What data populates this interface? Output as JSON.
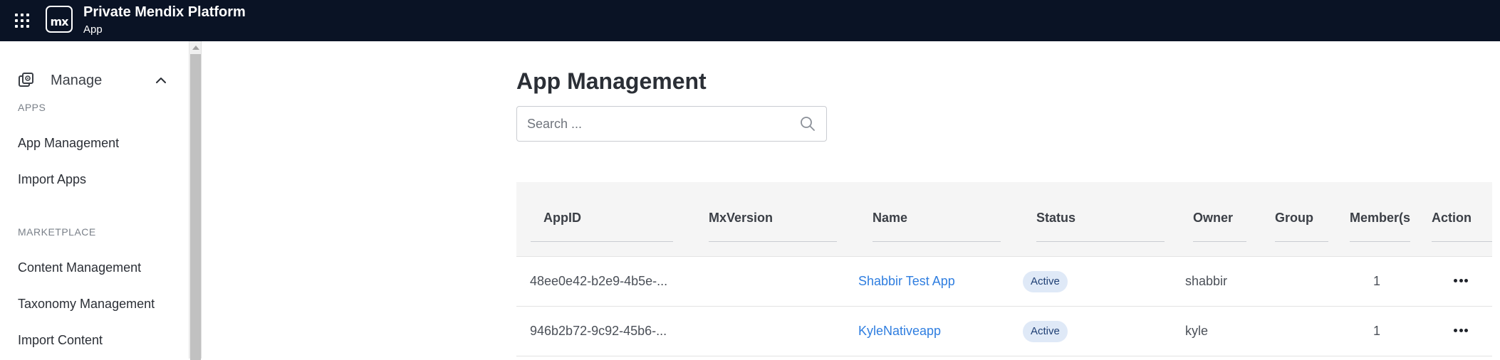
{
  "header": {
    "title": "Private Mendix Platform",
    "subtitle": "App",
    "logo_text": "mx",
    "menu_icon": "app-grid-icon",
    "background": "#0a1325"
  },
  "sidebar": {
    "group_label": "Manage",
    "group_icon": "manage-icon",
    "sections": [
      {
        "label": "APPS",
        "items": [
          {
            "label": "App Management"
          },
          {
            "label": "Import Apps"
          }
        ]
      },
      {
        "label": "MARKETPLACE",
        "items": [
          {
            "label": "Content Management"
          },
          {
            "label": "Taxonomy Management"
          },
          {
            "label": "Import Content"
          }
        ]
      }
    ]
  },
  "main": {
    "title": "App Management",
    "search": {
      "placeholder": "Search ...",
      "value": ""
    },
    "table": {
      "columns": [
        "AppID",
        "MxVersion",
        "Name",
        "Status",
        "Owner",
        "Group",
        "Member(s",
        "Action"
      ],
      "rows": [
        {
          "app_id": "48ee0e42-b2e9-4b5e-...",
          "mx_version": "",
          "name": "Shabbir Test App",
          "status": "Active",
          "owner": "shabbir",
          "group": "",
          "members": "1"
        },
        {
          "app_id": "946b2b72-9c92-45b6-...",
          "mx_version": "",
          "name": "KyleNativeapp",
          "status": "Active",
          "owner": "kyle",
          "group": "",
          "members": "1"
        }
      ]
    }
  },
  "colors": {
    "accent_link": "#2f7ee0",
    "badge_bg": "#dfe9f7",
    "badge_text": "#1f3f74"
  }
}
